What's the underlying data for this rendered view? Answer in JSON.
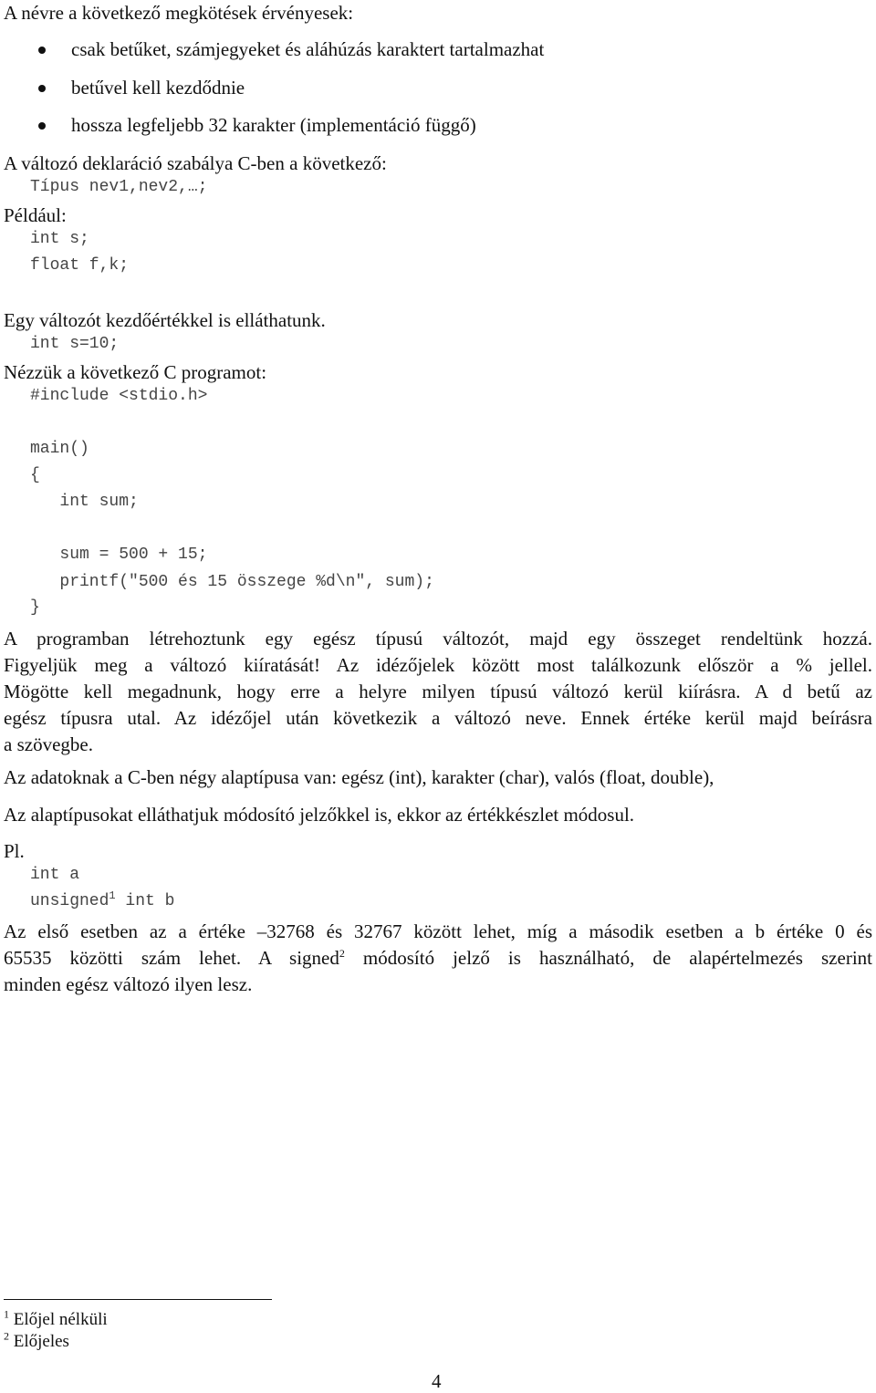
{
  "intro": "A névre a következő megkötések érvényesek:",
  "rules": [
    "csak betűket, számjegyeket és aláhúzás karaktert tartalmazhat",
    "betűvel kell kezdődnie",
    "hossza legfeljebb 32 karakter (implementáció függő)"
  ],
  "declaration": {
    "heading": "A változó deklaráció szabálya C-ben a következő:",
    "syntax": "Típus nev1,nev2,…;",
    "example_label": "Például:",
    "examples": [
      "int s;",
      "float f,k;"
    ]
  },
  "initialization": {
    "text": "Egy változót kezdőértékkel is elláthatunk.",
    "code": "int s=10;"
  },
  "program": {
    "heading": "Nézzük a következő C programot:",
    "lines": [
      "#include <stdio.h>",
      "",
      "main()",
      "{",
      "   int sum;",
      "",
      "   sum = 500 + 15;",
      "   printf(\"500 és 15 összege %d\\n\", sum);",
      "}"
    ]
  },
  "explanation_lines": [
    "A programban létrehoztunk egy egész típusú változót, majd egy összeget rendeltünk hozzá.",
    "Figyeljük meg a változó kiíratását! Az idézőjelek között most találkozunk először a % jellel.",
    "Mögötte kell megadnunk, hogy erre a helyre milyen típusú változó kerül kiírásra. A d betű az",
    "egész típusra utal. Az idézőjel után következik a változó neve. Ennek értéke kerül majd beírásra",
    "a szövegbe."
  ],
  "types_text": "Az adatoknak a C-ben négy alaptípusa van: egész (int), karakter (char), valós (float, double),",
  "modifiers_text": "Az alaptípusokat elláthatjuk módosító jelzőkkel is, ekkor az értékkészlet módosul.",
  "example2": {
    "label": "Pl.",
    "line1": "int a",
    "line2_pre": "unsigned",
    "line2_sup": "1",
    "line2_post": " int b"
  },
  "range_para": {
    "line1": "Az első esetben az a értéke –32768 és 32767 között lehet, míg a második esetben a b értéke 0 és",
    "line2_pre": "65535 közötti szám lehet. A signed",
    "line2_sup": "2",
    "line2_post": " módosító jelző is használható, de alapértelmezés szerint",
    "line3": "minden egész változó ilyen lesz."
  },
  "footnotes": [
    {
      "mark": "1",
      "text": "Előjel nélküli"
    },
    {
      "mark": "2",
      "text": "Előjeles"
    }
  ],
  "page_number": "4"
}
